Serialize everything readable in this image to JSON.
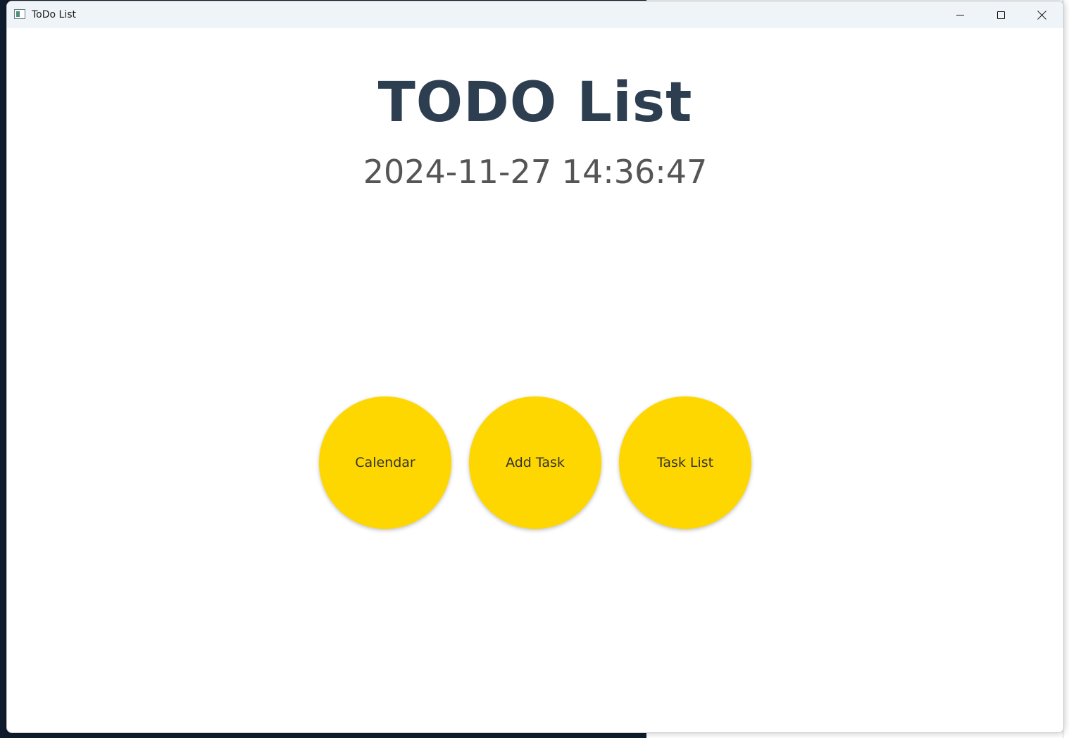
{
  "window": {
    "title": "ToDo List",
    "icon": "app-window-icon",
    "controls": {
      "minimize_icon": "minimize-icon",
      "maximize_icon": "maximize-icon",
      "close_icon": "close-icon"
    }
  },
  "main": {
    "heading": "TODO List",
    "datetime": "2024-11-27 14:36:47",
    "buttons": [
      {
        "label": "Calendar"
      },
      {
        "label": "Add Task"
      },
      {
        "label": "Task List"
      }
    ]
  },
  "colors": {
    "heading": "#2c3e50",
    "datetime": "#555555",
    "button_fill": "#ffd700",
    "button_text": "#333333",
    "titlebar": "#eff4f9"
  }
}
